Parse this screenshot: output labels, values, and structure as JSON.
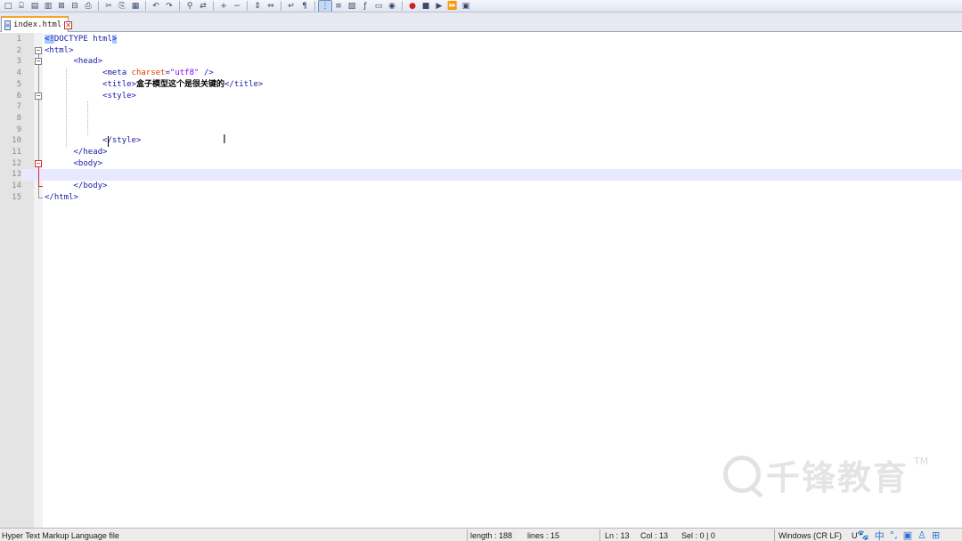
{
  "toolbar": {
    "icons": [
      "new-file-icon",
      "open-file-icon",
      "save-icon",
      "save-all-icon",
      "close-icon",
      "close-all-icon",
      "print-icon",
      "cut-icon",
      "copy-icon",
      "paste-icon",
      "undo-icon",
      "redo-icon",
      "find-icon",
      "replace-icon",
      "zoom-in-icon",
      "zoom-out-icon",
      "sync-vertical-icon",
      "sync-horizontal-icon",
      "word-wrap-icon",
      "show-all-chars-icon",
      "indent-guide-icon",
      "udl-icon",
      "doc-map-icon",
      "function-list-icon",
      "folder-workspace-icon",
      "monitoring-icon",
      "record-macro-icon",
      "stop-macro-icon",
      "play-macro-icon",
      "run-macro-multiple-icon",
      "save-macro-icon"
    ]
  },
  "tab": {
    "label": "index.html",
    "close_glyph": "✕"
  },
  "editor": {
    "line_numbers": [
      "1",
      "2",
      "3",
      "4",
      "5",
      "6",
      "7",
      "8",
      "9",
      "10",
      "11",
      "12",
      "13",
      "14",
      "15"
    ],
    "lines": [
      {
        "indent": "",
        "parts": [
          {
            "t": "tag",
            "v": "<!DOCTYPE html>"
          }
        ]
      },
      {
        "indent": "",
        "parts": [
          {
            "t": "tag",
            "v": "<html>"
          }
        ]
      },
      {
        "indent": "      ",
        "parts": [
          {
            "t": "tag",
            "v": "<head>"
          }
        ]
      },
      {
        "indent": "            ",
        "parts": [
          {
            "t": "tag",
            "v": "<meta "
          },
          {
            "t": "attr",
            "v": "charset"
          },
          {
            "t": "tag",
            "v": "="
          },
          {
            "t": "str",
            "v": "\"utf8\""
          },
          {
            "t": "tag",
            "v": " />"
          }
        ]
      },
      {
        "indent": "            ",
        "parts": [
          {
            "t": "tag",
            "v": "<title>"
          },
          {
            "t": "txt",
            "v": "盒子模型这个是很关键的"
          },
          {
            "t": "tag",
            "v": "</title>"
          }
        ]
      },
      {
        "indent": "            ",
        "parts": [
          {
            "t": "tag",
            "v": "<style>"
          }
        ]
      },
      {
        "indent": "",
        "parts": []
      },
      {
        "indent": "",
        "parts": []
      },
      {
        "indent": "",
        "parts": []
      },
      {
        "indent": "            ",
        "parts": [
          {
            "t": "tag",
            "v": "</style>"
          }
        ]
      },
      {
        "indent": "      ",
        "parts": [
          {
            "t": "tag",
            "v": "</head>"
          }
        ]
      },
      {
        "indent": "      ",
        "parts": [
          {
            "t": "tag",
            "v": "<body>"
          }
        ]
      },
      {
        "indent": "",
        "parts": []
      },
      {
        "indent": "      ",
        "parts": [
          {
            "t": "tag",
            "v": "</body>"
          }
        ]
      },
      {
        "indent": "",
        "parts": [
          {
            "t": "tag",
            "v": "</html>"
          }
        ]
      }
    ],
    "current_line": 13
  },
  "watermark": {
    "text": "千锋教育",
    "tm": "TM"
  },
  "statusbar": {
    "file_type": "Hyper Text Markup Language file",
    "length": "length : 188",
    "lines": "lines : 15",
    "ln": "Ln : 13",
    "col": "Col : 13",
    "sel": "Sel : 0 | 0",
    "eol": "Windows (CR LF)",
    "encoding": "U",
    "ime_icons": [
      "paw-icon",
      "中",
      "°,",
      "toolbox-icon",
      "user-icon",
      "grid-icon"
    ]
  },
  "colors": {
    "tag": "#1a1aa6",
    "attr": "#e03a00",
    "string": "#8000ff",
    "current_line": "#e8e8ff",
    "tab_accent": "#f5a623"
  }
}
